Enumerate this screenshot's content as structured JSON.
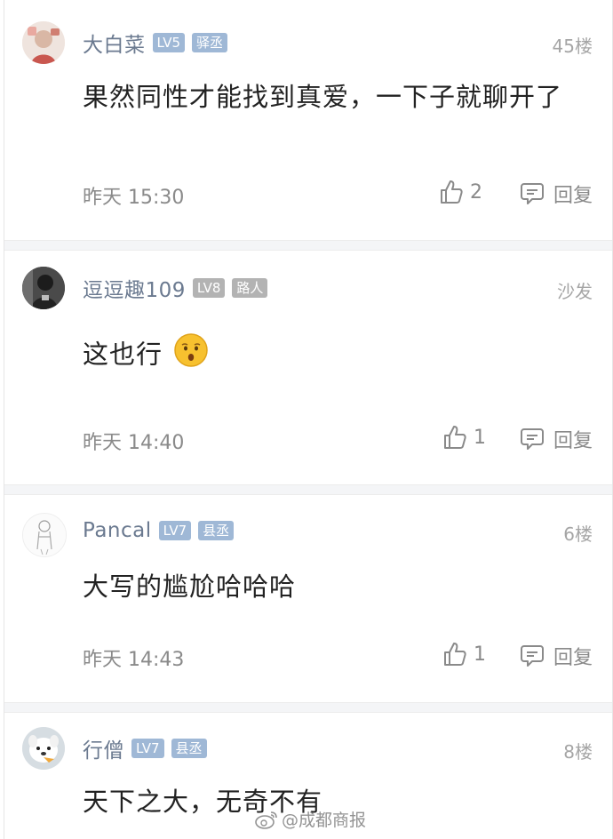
{
  "comments": [
    {
      "username": "大白菜",
      "level": "LV5",
      "title": "驿丞",
      "floor": "45楼",
      "text": "果然同性才能找到真爱，一下子就聊开了",
      "time": "昨天 15:30",
      "likes": "2",
      "reply_label": "回复",
      "avatar_icon": "avatar-photo-icon"
    },
    {
      "username": "逗逗趣109",
      "level": "LV8",
      "title": "路人",
      "floor": "沙发",
      "text": "这也行",
      "emoji": "hushed-face-emoji",
      "time": "昨天 14:40",
      "likes": "1",
      "reply_label": "回复",
      "avatar_icon": "avatar-photo-icon"
    },
    {
      "username": "Pancal",
      "level": "LV7",
      "title": "县丞",
      "floor": "6楼",
      "text": "大写的尴尬哈哈哈",
      "time": "昨天 14:43",
      "likes": "1",
      "reply_label": "回复",
      "avatar_icon": "avatar-sketch-icon"
    },
    {
      "username": "行僧",
      "level": "LV7",
      "title": "县丞",
      "floor": "8楼",
      "text": "天下之大，无奇不有",
      "avatar_icon": "avatar-dog-icon"
    }
  ],
  "watermark": {
    "text": "@成都商报",
    "icon": "weibo-icon"
  },
  "colors": {
    "username": "#6b7a90",
    "badge_blue": "#9fb8d6",
    "badge_gray": "#b3b3b3",
    "meta": "#8a8a8a",
    "separator": "#f4f5f7"
  }
}
